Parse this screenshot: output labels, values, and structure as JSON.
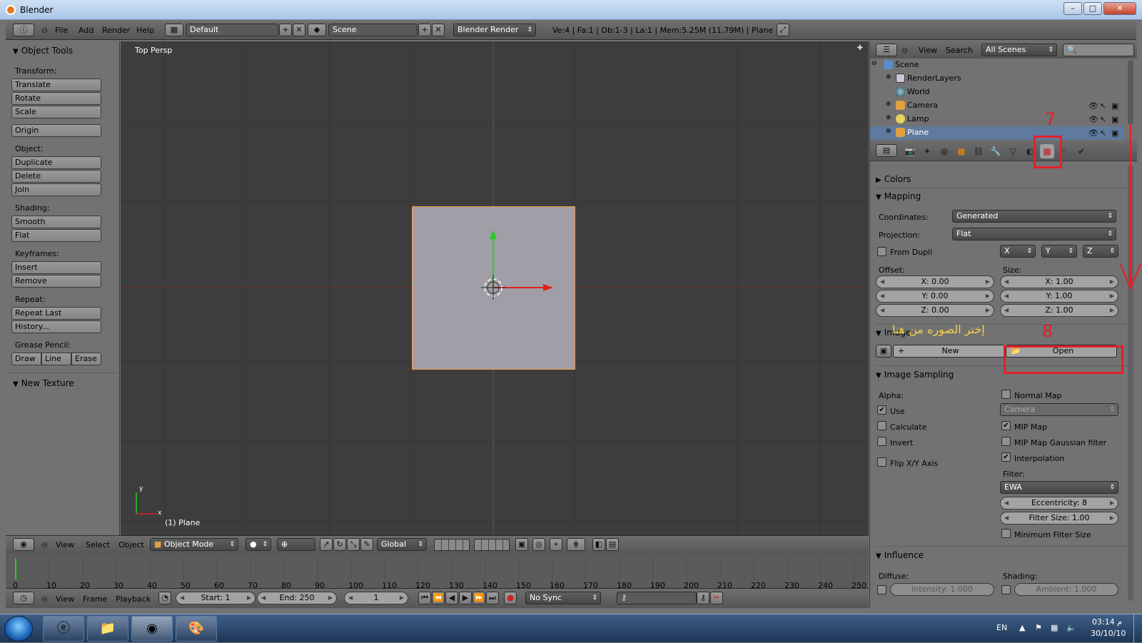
{
  "window": {
    "title": "Blender",
    "buttons": {
      "min": "–",
      "max": "□",
      "close": "✕"
    }
  },
  "menubar": {
    "items": [
      "File",
      "Add",
      "Render",
      "Help"
    ],
    "layout_value": "Default",
    "scene_value": "Scene",
    "render_engine": "Blender Render",
    "stats": "Ve:4 | Fa:1 | Ob:1-3 | La:1 | Mem:5.25M (11.79M) | Plane"
  },
  "tools": {
    "object_tools_title": "Object Tools",
    "groups": {
      "transform": {
        "label": "Transform:",
        "buttons": [
          "Translate",
          "Rotate",
          "Scale"
        ]
      },
      "origin": "Origin",
      "object": {
        "label": "Object:",
        "buttons": [
          "Duplicate",
          "Delete",
          "Join"
        ]
      },
      "shading": {
        "label": "Shading:",
        "buttons": [
          "Smooth",
          "Flat"
        ]
      },
      "keyframes": {
        "label": "Keyframes:",
        "buttons": [
          "Insert",
          "Remove"
        ]
      },
      "repeat": {
        "label": "Repeat:",
        "buttons": [
          "Repeat Last",
          "History..."
        ]
      },
      "grease": {
        "label": "Grease Pencil:",
        "buttons": [
          "Draw",
          "Line",
          "Erase"
        ]
      }
    },
    "new_texture_title": "New Texture"
  },
  "viewport": {
    "title": "Top Persp",
    "object_label": "(1) Plane",
    "axis_y": "y",
    "axis_x": "x"
  },
  "view_header": {
    "items": [
      "View",
      "Select",
      "Object"
    ],
    "mode": "Object Mode",
    "orientation": "Global"
  },
  "timeline": {
    "ticks": [
      "0",
      "10",
      "20",
      "30",
      "40",
      "50",
      "60",
      "70",
      "80",
      "90",
      "100",
      "110",
      "120",
      "130",
      "140",
      "150",
      "160",
      "170",
      "180",
      "190",
      "200",
      "210",
      "220",
      "230",
      "240",
      "250"
    ],
    "menu": [
      "View",
      "Frame",
      "Playback"
    ],
    "start": "Start: 1",
    "end": "End: 250",
    "current": "1",
    "sync": "No Sync"
  },
  "outliner": {
    "menu": [
      "View",
      "Search"
    ],
    "scenes": "All Scenes",
    "rows": [
      "Scene",
      "RenderLayers",
      "World",
      "Camera",
      "Lamp",
      "Plane"
    ]
  },
  "properties": {
    "colors": "Colors",
    "mapping": {
      "title": "Mapping",
      "coordinates_label": "Coordinates:",
      "coordinates_value": "Generated",
      "projection_label": "Projection:",
      "projection_value": "Flat",
      "from_dupli": "From Dupli",
      "axis_x": "X",
      "axis_y": "Y",
      "axis_z": "Z",
      "offset_label": "Offset:",
      "size_label": "Size:",
      "offset": [
        "X: 0.00",
        "Y: 0.00",
        "Z: 0.00"
      ],
      "size": [
        "X: 1.00",
        "Y: 1.00",
        "Z: 1.00"
      ]
    },
    "image": {
      "title": "Image",
      "new": "New",
      "open": "Open"
    },
    "sampling": {
      "title": "Image Sampling",
      "alpha_label": "Alpha:",
      "use": "Use",
      "calculate": "Calculate",
      "invert": "Invert",
      "flip": "Flip X/Y Axis",
      "normal_map": "Normal Map",
      "camera": "Camera",
      "mip_map": "MIP Map",
      "mip_gauss": "MIP Map Gaussian filter",
      "interpolation": "Interpolation",
      "filter_label": "Filter:",
      "filter_value": "EWA",
      "eccentricity": "Eccentricity: 8",
      "filter_size": "Filter Size: 1.00",
      "min_filter": "Minimum Filter Size"
    },
    "influence": {
      "title": "Influence",
      "diffuse_label": "Diffuse:",
      "shading_label": "Shading:",
      "intensity": "Intensity: 1.000",
      "ambient": "Ambient: 1.000"
    }
  },
  "annotations": {
    "seven": "7",
    "eight": "8",
    "arabic": "إختر الصوره من هنا"
  },
  "taskbar": {
    "lang": "EN",
    "time": "03:14 م",
    "date": "30/10/10"
  },
  "colors": {
    "selection": "#f29a3a",
    "annotation": "#e3202a",
    "arabic_text": "#f0d24a"
  }
}
